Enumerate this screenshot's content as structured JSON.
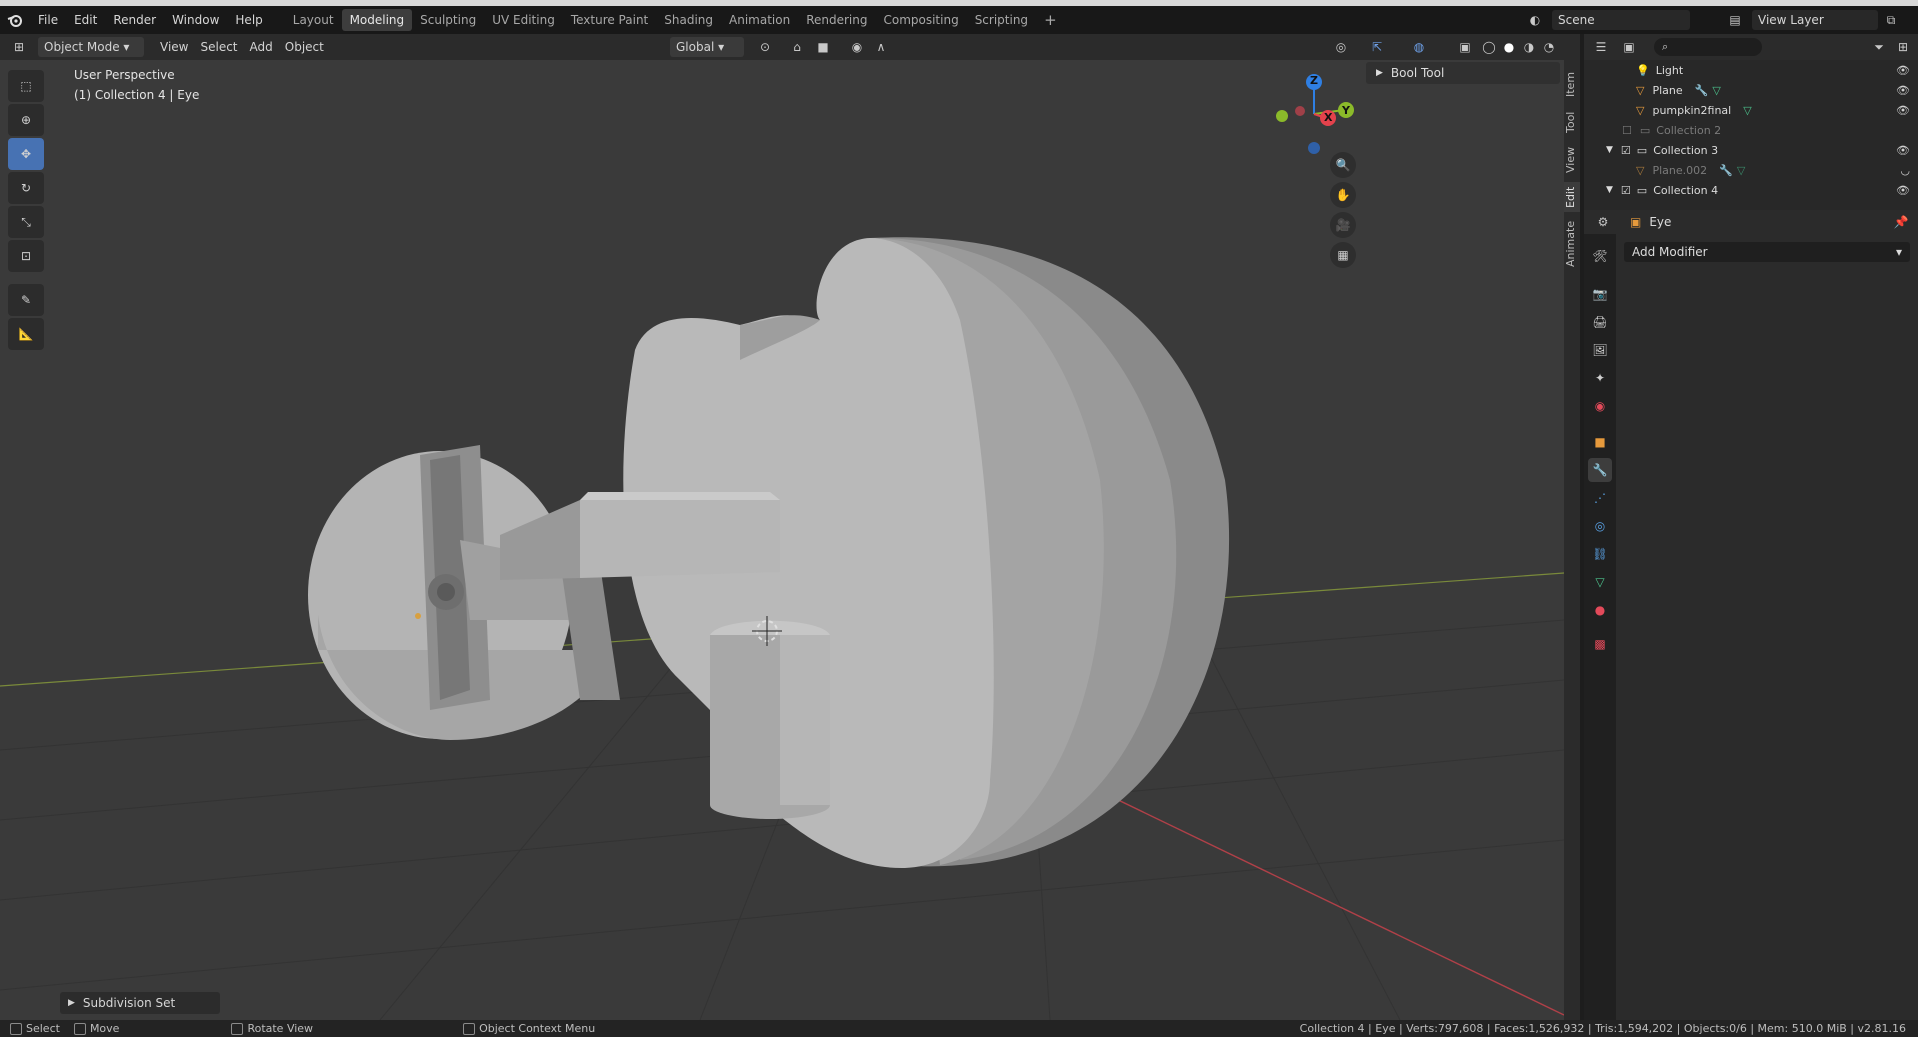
{
  "menu": {
    "items": [
      "File",
      "Edit",
      "Render",
      "Window",
      "Help"
    ]
  },
  "workspaces": {
    "tabs": [
      "Layout",
      "Modeling",
      "Sculpting",
      "UV Editing",
      "Texture Paint",
      "Shading",
      "Animation",
      "Rendering",
      "Compositing",
      "Scripting"
    ],
    "active": "Modeling",
    "add": "+"
  },
  "scene": {
    "name": "Scene",
    "view_layer": "View Layer"
  },
  "viewport_header": {
    "mode": "Object Mode",
    "menus": [
      "View",
      "Select",
      "Add",
      "Object"
    ],
    "orientation": "Global"
  },
  "viewport": {
    "perspective": "User Perspective",
    "context": "(1) Collection 4 | Eye",
    "bool_tool": "Bool Tool",
    "gizmo_axes": {
      "z": "Z",
      "x": "X",
      "y": "Y"
    },
    "side_tabs": [
      "Item",
      "Tool",
      "View",
      "Edit",
      "Animate"
    ],
    "last_operator": "Subdivision Set"
  },
  "outliner": {
    "rows": [
      {
        "label": "Light",
        "type": "light"
      },
      {
        "label": "Plane",
        "type": "mesh"
      },
      {
        "label": "pumpkin2final",
        "type": "mesh"
      },
      {
        "label": "Collection 2",
        "type": "collection",
        "excluded": true
      },
      {
        "label": "Collection 3",
        "type": "collection"
      },
      {
        "label": "Plane.002",
        "type": "mesh",
        "dim": true
      },
      {
        "label": "Collection 4",
        "type": "collection"
      }
    ]
  },
  "properties": {
    "object_name": "Eye",
    "add_modifier": "Add Modifier"
  },
  "statusbar": {
    "select": "Select",
    "move": "Move",
    "rotate": "Rotate View",
    "context_menu": "Object Context Menu",
    "stats": "Collection 4 | Eye | Verts:797,608 | Faces:1,526,932 | Tris:1,594,202 | Objects:0/6 | Mem: 510.0 MiB | v2.81.16"
  },
  "colors": {
    "accent": "#4772b3",
    "x_axis": "#e3424c",
    "y_axis": "#8bba2a",
    "z_axis": "#2f7fe3",
    "viewport_bg": "#3a3a3a"
  }
}
